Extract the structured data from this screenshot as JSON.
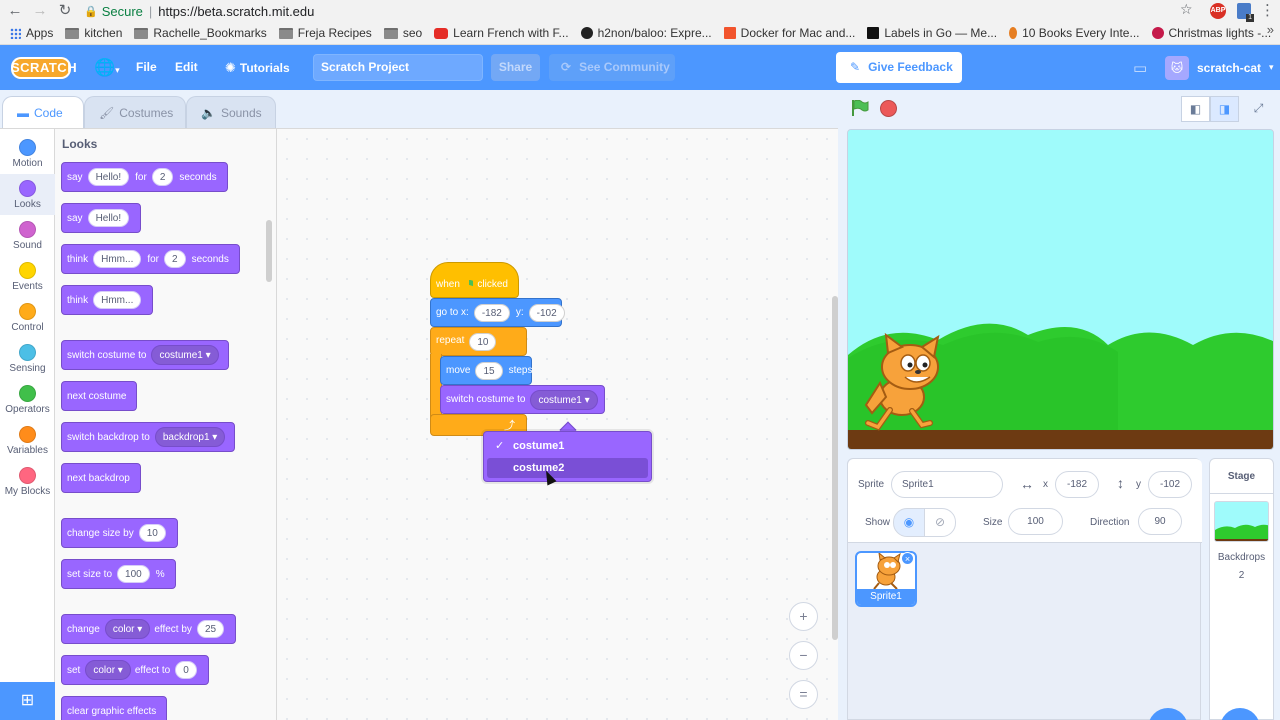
{
  "browser": {
    "secure_label": "Secure",
    "url": "https://beta.scratch.mit.edu",
    "bookmarks": [
      "Apps",
      "kitchen",
      "Rachelle_Bookmarks",
      "Freja Recipes",
      "seo",
      "Learn French with F...",
      "h2non/baloo: Expre...",
      "Docker for Mac and...",
      "Labels in Go — Me...",
      "10 Books Every Inte...",
      "Christmas lights -..."
    ],
    "ext_badge": "ABP",
    "ext_count": "1"
  },
  "menubar": {
    "logo": "SCRATCH",
    "file": "File",
    "edit": "Edit",
    "tutorials": "Tutorials",
    "project_title": "Scratch Project",
    "share": "Share",
    "see_community": "See Community",
    "feedback": "Give Feedback",
    "username": "scratch-cat"
  },
  "tabs": {
    "code": "Code",
    "costumes": "Costumes",
    "sounds": "Sounds"
  },
  "categories": [
    {
      "label": "Motion",
      "color": "#4c97ff"
    },
    {
      "label": "Looks",
      "color": "#9966ff"
    },
    {
      "label": "Sound",
      "color": "#cf63cf"
    },
    {
      "label": "Events",
      "color": "#ffd500"
    },
    {
      "label": "Control",
      "color": "#ffab19"
    },
    {
      "label": "Sensing",
      "color": "#4cbfe6"
    },
    {
      "label": "Operators",
      "color": "#40bf4a"
    },
    {
      "label": "Variables",
      "color": "#ff8c1a"
    },
    {
      "label": "My Blocks",
      "color": "#ff6680"
    }
  ],
  "palette": {
    "heading": "Looks",
    "say_for": {
      "a": "say",
      "b": "Hello!",
      "c": "for",
      "d": "2",
      "e": "seconds"
    },
    "say": {
      "a": "say",
      "b": "Hello!"
    },
    "think_for": {
      "a": "think",
      "b": "Hmm...",
      "c": "for",
      "d": "2",
      "e": "seconds"
    },
    "think": {
      "a": "think",
      "b": "Hmm..."
    },
    "switch_costume": {
      "a": "switch costume to",
      "b": "costume1"
    },
    "next_costume": "next costume",
    "switch_backdrop": {
      "a": "switch backdrop to",
      "b": "backdrop1"
    },
    "next_backdrop": "next backdrop",
    "change_size": {
      "a": "change size by",
      "b": "10"
    },
    "set_size": {
      "a": "set size to",
      "b": "100",
      "c": "%"
    },
    "change_effect": {
      "a": "change",
      "b": "color",
      "c": "effect by",
      "d": "25"
    },
    "set_effect": {
      "a": "set",
      "b": "color",
      "c": "effect to",
      "d": "0"
    },
    "clear_effects": "clear graphic effects"
  },
  "script": {
    "when": "when",
    "clicked": "clicked",
    "goto": {
      "a": "go to x:",
      "x": "-182",
      "b": "y:",
      "y": "-102"
    },
    "repeat": {
      "a": "repeat",
      "n": "10"
    },
    "move": {
      "a": "move",
      "n": "15",
      "b": "steps"
    },
    "switch": {
      "a": "switch costume to",
      "b": "costume1"
    },
    "loop_arrow": "⤴"
  },
  "dropdown": {
    "options": [
      "costume1",
      "costume2"
    ],
    "selected_index": 0,
    "hover_index": 1,
    "check": "✓"
  },
  "zoom": {
    "in": "+",
    "out": "−",
    "reset": "="
  },
  "sprite_info": {
    "sprite_label": "Sprite",
    "sprite_name": "Sprite1",
    "x_label": "x",
    "x": "-182",
    "y_label": "y",
    "y": "-102",
    "show_label": "Show",
    "size_label": "Size",
    "size": "100",
    "direction_label": "Direction",
    "direction": "90"
  },
  "sprite_list": [
    {
      "name": "Sprite1"
    }
  ],
  "stage_pane": {
    "header": "Stage",
    "backdrops_label": "Backdrops",
    "backdrops_count": "2"
  }
}
